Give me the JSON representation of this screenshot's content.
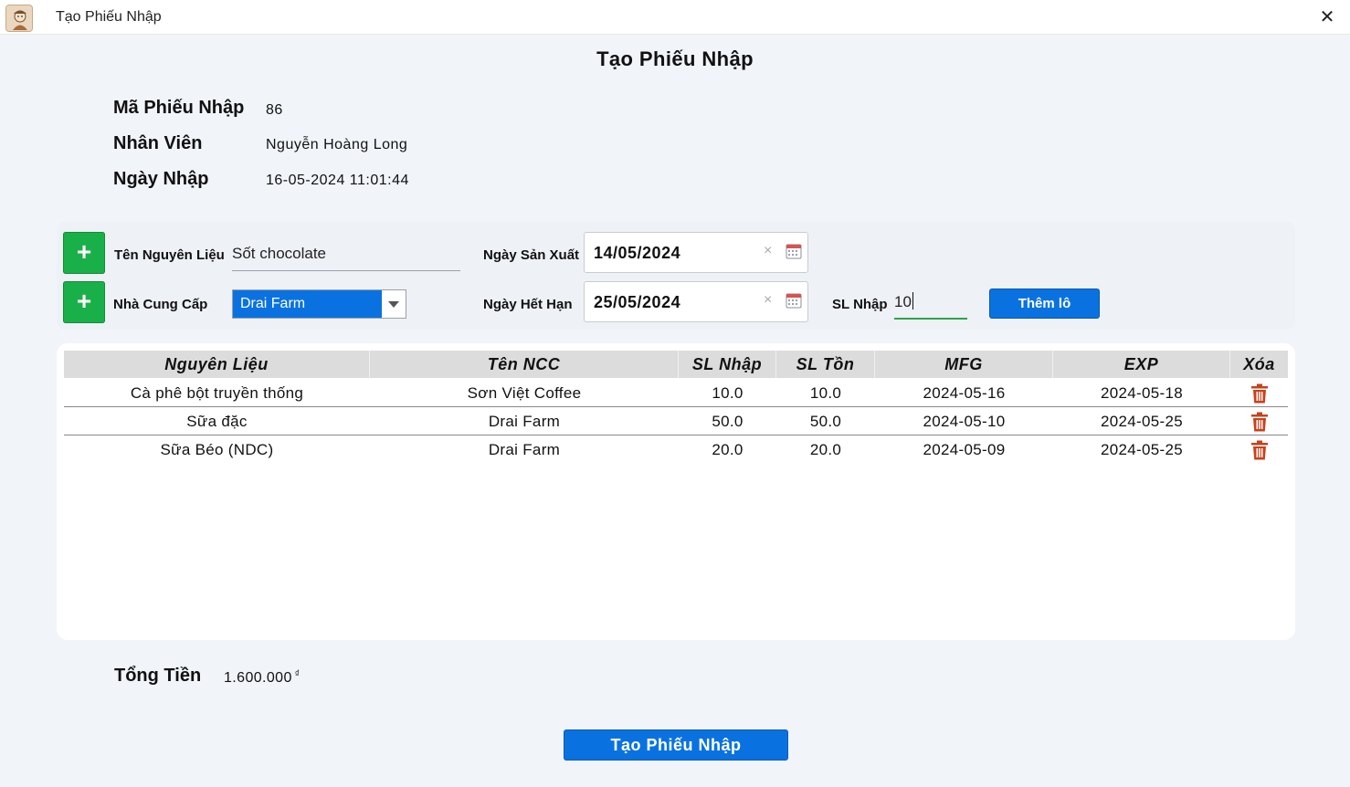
{
  "window": {
    "title": "Tạo Phiếu Nhập",
    "close_glyph": "✕"
  },
  "page_title": "Tạo Phiếu Nhập",
  "info": {
    "ma_label": "Mã Phiếu Nhập",
    "ma_value": "86",
    "nv_label": "Nhân Viên",
    "nv_value": "Nguyễn Hoàng Long",
    "ngay_label": "Ngày Nhập",
    "ngay_value": "16-05-2024 11:01:44"
  },
  "form": {
    "plus_glyph": "+",
    "ingredient_label": "Tên Nguyên Liệu",
    "ingredient_value": "Sốt chocolate",
    "supplier_label": "Nhà Cung Cấp",
    "supplier_value": "Drai Farm",
    "mfg_label": "Ngày Sản Xuất",
    "mfg_value": "14/05/2024",
    "exp_label": "Ngày Hết Hạn",
    "exp_value": "25/05/2024",
    "clear_glyph": "×",
    "qty_label": "SL Nhập",
    "qty_value": "10",
    "add_lot_label": "Thêm lô"
  },
  "table": {
    "headers": [
      "Nguyên Liệu",
      "Tên NCC",
      "SL Nhập",
      "SL Tồn",
      "MFG",
      "EXP",
      "Xóa"
    ],
    "rows": [
      [
        "Cà phê bột truyền thống",
        "Sơn Việt Coffee",
        "10.0",
        "10.0",
        "2024-05-16",
        "2024-05-18"
      ],
      [
        "Sữa đặc",
        "Drai Farm",
        "50.0",
        "50.0",
        "2024-05-10",
        "2024-05-25"
      ],
      [
        "Sữa Béo (NDC)",
        "Drai Farm",
        "20.0",
        "20.0",
        "2024-05-09",
        "2024-05-25"
      ]
    ]
  },
  "total": {
    "label": "Tổng Tiền",
    "value": "1.600.000",
    "currency": "₫"
  },
  "submit_label": "Tạo Phiếu Nhập",
  "colors": {
    "primary": "#0a72e0",
    "add_green": "#1ab049",
    "delete_red": "#c7421b",
    "focus_green": "#2ea34a"
  }
}
